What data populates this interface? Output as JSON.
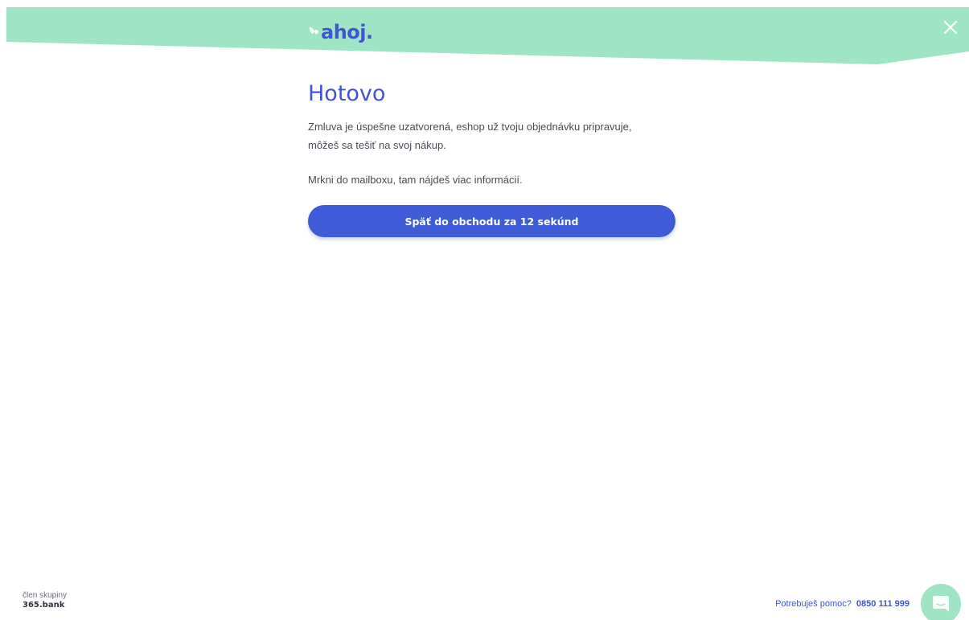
{
  "header": {
    "logo_text": "ahoj.",
    "close_label": "×"
  },
  "main": {
    "title": "Hotovo",
    "paragraph_1_line_1": "Zmluva je úspešne uzatvorená, eshop už tvoju objednávku pripravuje,",
    "paragraph_1_line_2": "môžeš sa tešiť na svoj nákup.",
    "paragraph_2": "Mrkni do mailboxu, tam nájdeš viac informácií.",
    "button_label": "Späť do obchodu za 12 sekúnd"
  },
  "footer": {
    "member_label": "člen skupiny",
    "member_brand": "365.bank",
    "help_label": "Potrebuješ pomoc?",
    "help_phone": "0850 111 999"
  },
  "icons": {
    "close": "close-icon",
    "chat": "chat-icon",
    "logo_mark": "logo-mark-icon"
  },
  "colors": {
    "brand_blue": "#3f55d6",
    "header_mint": "#a0e4c6",
    "button_blue": "#3f5bd8"
  }
}
